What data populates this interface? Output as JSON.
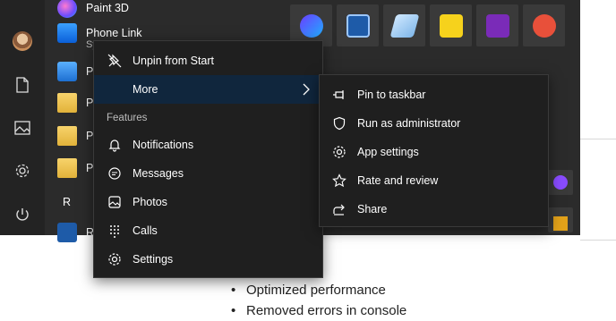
{
  "start_menu": {
    "apps": [
      {
        "name": "Paint 3D"
      },
      {
        "name": "Phone Link",
        "subtitle": "Sy"
      },
      {
        "name": "Pl"
      },
      {
        "name": "Pa"
      },
      {
        "name": "Pe"
      },
      {
        "name": "Pu"
      },
      {
        "name": "R",
        "is_letter_header": true
      },
      {
        "name": "R"
      }
    ],
    "rail_icons": [
      "avatar",
      "document-icon",
      "pictures-icon",
      "settings-gear-icon",
      "power-icon"
    ]
  },
  "context_menu": {
    "items": [
      {
        "label": "Unpin from Start",
        "icon": "unpin-icon"
      },
      {
        "label": "More",
        "icon": "",
        "has_submenu": true,
        "highlighted": true
      }
    ],
    "section_label": "Features",
    "features": [
      {
        "label": "Notifications",
        "icon": "bell-icon"
      },
      {
        "label": "Messages",
        "icon": "chat-icon"
      },
      {
        "label": "Photos",
        "icon": "image-icon"
      },
      {
        "label": "Calls",
        "icon": "dialpad-icon"
      },
      {
        "label": "Settings",
        "icon": "gear-icon"
      }
    ]
  },
  "submenu": {
    "items": [
      {
        "label": "Pin to taskbar",
        "icon": "pin-icon"
      },
      {
        "label": "Run as administrator",
        "icon": "shield-icon"
      },
      {
        "label": "App settings",
        "icon": "gear-icon"
      },
      {
        "label": "Rate and review",
        "icon": "star-icon"
      },
      {
        "label": "Share",
        "icon": "share-icon"
      }
    ]
  },
  "page_behind": {
    "bullets": [
      "Optimized performance",
      "Removed errors in console"
    ]
  },
  "colors": {
    "menu_bg": "#1f1f1f",
    "highlight": "#10263d",
    "start_bg": "#2b2b2b"
  }
}
